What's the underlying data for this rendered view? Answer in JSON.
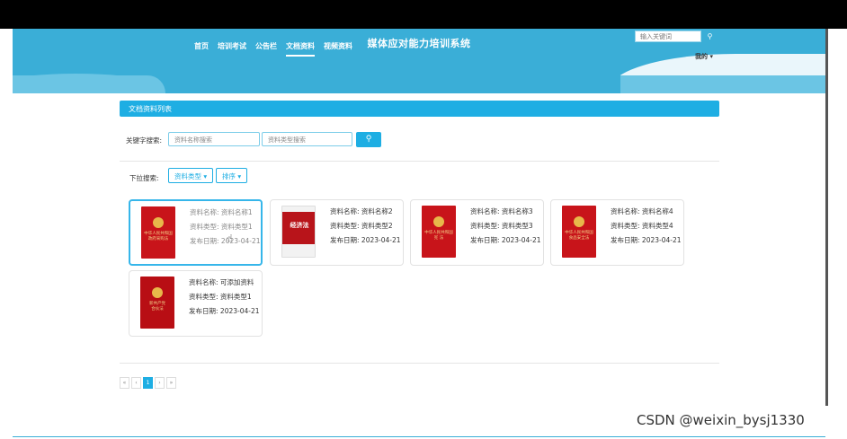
{
  "header": {
    "title": "媒体应对能力培训系统",
    "nav": [
      "首页",
      "培训考试",
      "公告栏",
      "文档资料",
      "视频资料"
    ],
    "active_nav": "文档资料",
    "search_placeholder": "输入关键词",
    "user_menu": "我的"
  },
  "section_title": "文档资料列表",
  "search": {
    "label": "关键字搜索:",
    "name_placeholder": "资料名称搜索",
    "type_placeholder": "资料类型搜索"
  },
  "dropdowns": {
    "label": "下拉搜索:",
    "type_btn": "资料类型",
    "sort_btn": "排序"
  },
  "cards": [
    {
      "cover_text": "中华人民共和国\n政府采购法",
      "name": "资料名称1",
      "type": "资料类型1",
      "date": "2023-04-21",
      "active": true
    },
    {
      "cover_text": "经济法",
      "name": "资料名称2",
      "type": "资料类型2",
      "date": "2023-04-21"
    },
    {
      "cover_text": "中华人民共和国\n宪 法",
      "name": "资料名称3",
      "type": "资料类型3",
      "date": "2023-04-21"
    },
    {
      "cover_text": "中华人民共和国\n食品安全法",
      "name": "资料名称4",
      "type": "资料类型4",
      "date": "2023-04-21"
    },
    {
      "cover_text": "新共产党\n合伙法",
      "name": "可添加资料",
      "type": "资料类型1",
      "date": "2023-04-21"
    }
  ],
  "card_labels": {
    "name": "资料名称:",
    "type": "资料类型:",
    "date": "发布日期:"
  },
  "pager": [
    "«",
    "‹",
    "1",
    "›",
    "»"
  ],
  "pager_current": "1",
  "watermark": "CSDN @weixin_bysj1330",
  "colors": {
    "header": "#3aaed7",
    "accent": "#1eaee3"
  }
}
